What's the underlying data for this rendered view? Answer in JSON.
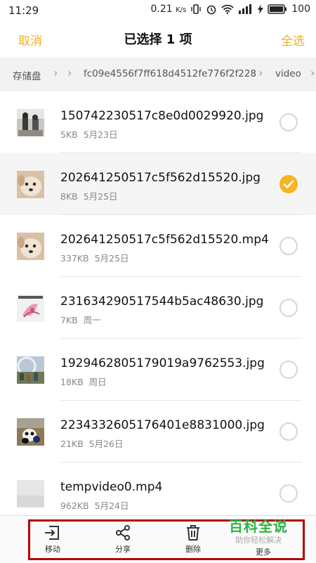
{
  "status_bar": {
    "time": "11:29",
    "speed": "0.21",
    "speed_unit": "K/s",
    "battery": "100"
  },
  "header": {
    "cancel_label": "取消",
    "title": "已选择 1 项",
    "select_all_label": "全选"
  },
  "breadcrumb": [
    "存储盘",
    "fc09e4556f7ff618d4512fe776f2f228",
    "video"
  ],
  "files": [
    {
      "name": "150742230517c8e0d0029920.jpg",
      "size": "5KB",
      "date": "5月23日",
      "selected": false,
      "thumb": "people-thumbnail"
    },
    {
      "name": "202641250517c5f562d15520.jpg",
      "size": "8KB",
      "date": "5月25日",
      "selected": true,
      "thumb": "dog-thumbnail"
    },
    {
      "name": "202641250517c5f562d15520.mp4",
      "size": "337KB",
      "date": "5月25日",
      "selected": false,
      "thumb": "dog-thumbnail"
    },
    {
      "name": "231634290517544b5ac48630.jpg",
      "size": "7KB",
      "date": "周一",
      "selected": false,
      "thumb": "flower-thumbnail"
    },
    {
      "name": "1929462805179019a9762553.jpg",
      "size": "18KB",
      "date": "周日",
      "selected": false,
      "thumb": "crowd-thumbnail"
    },
    {
      "name": "2234332605176401e8831000.jpg",
      "size": "21KB",
      "date": "5月26日",
      "selected": false,
      "thumb": "panda-thumbnail"
    },
    {
      "name": "tempvideo0.mp4",
      "size": "962KB",
      "date": "5月24日",
      "selected": false,
      "thumb": "video-thumbnail"
    }
  ],
  "toolbar": {
    "move_label": "移动",
    "share_label": "分享",
    "delete_label": "删除",
    "more_label": "更多"
  },
  "watermark": {
    "title": "百科全说",
    "subtitle": "助你轻松解决"
  },
  "colors": {
    "accent": "#f6b523",
    "highlight_box": "#b30000",
    "watermark_green": "#2fb344"
  }
}
